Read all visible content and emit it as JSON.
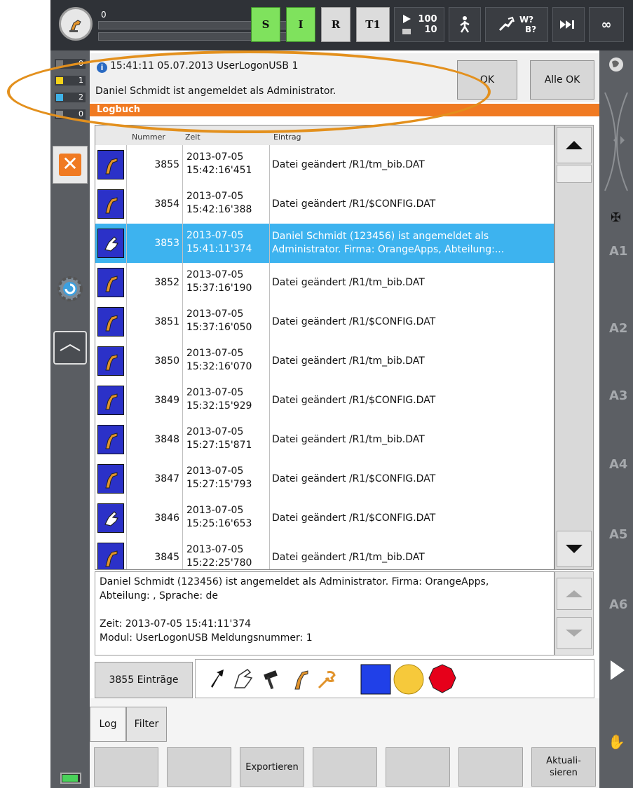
{
  "status_bar": {
    "progress_value": "0",
    "modes": [
      {
        "label": "S",
        "active": true
      },
      {
        "label": "I",
        "active": true
      },
      {
        "label": "R",
        "active": false
      },
      {
        "label": "T1",
        "active": false
      }
    ],
    "override_prog": "100",
    "override_hand": "10",
    "tool_top": "W?",
    "tool_bottom": "B?",
    "infinity": "∞"
  },
  "message_counters": [
    "0",
    "1",
    "2",
    "0"
  ],
  "message": {
    "time": "15:41:11 05.07.2013 UserLogonUSB 1",
    "text": "Daniel Schmidt ist angemeldet als Administrator.",
    "ok_label": "OK",
    "all_ok_label": "Alle OK"
  },
  "logbuch": {
    "title": "Logbuch",
    "columns": {
      "icon": "",
      "number": "Nummer",
      "time": "Zeit",
      "entry": "Eintrag"
    },
    "rows": [
      {
        "icon": "robot",
        "number": "3855",
        "date": "2013-07-05",
        "time": "15:42:16'451",
        "entry": "Datei geändert /R1/tm_bib.DAT",
        "selected": false
      },
      {
        "icon": "robot",
        "number": "3854",
        "date": "2013-07-05",
        "time": "15:42:16'388",
        "entry": "Datei geändert /R1/$CONFIG.DAT",
        "selected": false
      },
      {
        "icon": "hand",
        "number": "3853",
        "date": "2013-07-05",
        "time": "15:41:11'374",
        "entry": "Daniel Schmidt (123456) ist angemeldet als Administrator. Firma: OrangeApps, Abteilung:...",
        "selected": true
      },
      {
        "icon": "robot",
        "number": "3852",
        "date": "2013-07-05",
        "time": "15:37:16'190",
        "entry": "Datei geändert /R1/tm_bib.DAT",
        "selected": false
      },
      {
        "icon": "robot",
        "number": "3851",
        "date": "2013-07-05",
        "time": "15:37:16'050",
        "entry": "Datei geändert /R1/$CONFIG.DAT",
        "selected": false
      },
      {
        "icon": "robot",
        "number": "3850",
        "date": "2013-07-05",
        "time": "15:32:16'070",
        "entry": "Datei geändert /R1/tm_bib.DAT",
        "selected": false
      },
      {
        "icon": "robot",
        "number": "3849",
        "date": "2013-07-05",
        "time": "15:32:15'929",
        "entry": "Datei geändert /R1/$CONFIG.DAT",
        "selected": false
      },
      {
        "icon": "robot",
        "number": "3848",
        "date": "2013-07-05",
        "time": "15:27:15'871",
        "entry": "Datei geändert /R1/tm_bib.DAT",
        "selected": false
      },
      {
        "icon": "robot",
        "number": "3847",
        "date": "2013-07-05",
        "time": "15:27:15'793",
        "entry": "Datei geändert /R1/$CONFIG.DAT",
        "selected": false
      },
      {
        "icon": "hand",
        "number": "3846",
        "date": "2013-07-05",
        "time": "15:25:16'653",
        "entry": "Datei geändert /R1/$CONFIG.DAT",
        "selected": false
      },
      {
        "icon": "robot",
        "number": "3845",
        "date": "2013-07-05",
        "time": "15:22:25'780",
        "entry": "Datei geändert /R1/tm_bib.DAT",
        "selected": false
      }
    ]
  },
  "detail": {
    "line1": "Daniel Schmidt (123456) ist angemeldet als Administrator. Firma: OrangeApps,",
    "line2": "Abteilung: , Sprache: de",
    "line3": "Zeit: 2013-07-05 15:41:11'374",
    "line4": "Modul: UserLogonUSB  Meldungsnummer: 1"
  },
  "entry_count": "3855 Einträge",
  "tabs": {
    "log": "Log",
    "filter": "Filter"
  },
  "bottom_buttons": [
    "",
    "",
    "Exportieren",
    "",
    "",
    "",
    "Aktuali-\nsieren"
  ],
  "axes": [
    "A1",
    "A2",
    "A3",
    "A4",
    "A5",
    "A6"
  ],
  "colors": {
    "orange": "#f07a22",
    "selected": "#3db3ef",
    "icon_bg": "#2b31c8",
    "green": "#7fe25d"
  }
}
